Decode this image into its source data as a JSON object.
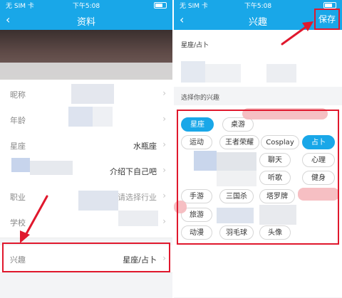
{
  "left": {
    "status": {
      "carrier": "无 SIM 卡",
      "time": "下午5:08"
    },
    "nav": {
      "back_icon": "‹",
      "title": "资料"
    },
    "rows": [
      {
        "label": "昵称",
        "value": ""
      },
      {
        "label": "年龄",
        "value": ""
      },
      {
        "label": "星座",
        "value": "水瓶座"
      },
      {
        "label": "",
        "value": "介绍下自己吧"
      },
      {
        "label": "职业",
        "value": "请选择行业"
      },
      {
        "label": "学校",
        "value": ""
      },
      {
        "label": "兴趣",
        "value": "星座/占卜"
      }
    ],
    "chevron": "›"
  },
  "right": {
    "status": {
      "carrier": "无 SIM 卡",
      "time": "下午5:08"
    },
    "nav": {
      "back_icon": "‹",
      "title": "兴趣",
      "save_label": "保存"
    },
    "current_interests": "星座/占卜",
    "choose_label": "选择你的兴趣",
    "tags": [
      {
        "label": "星座",
        "selected": true
      },
      {
        "label": "桌游",
        "selected": false
      },
      {
        "label": "运动",
        "selected": false
      },
      {
        "label": "王者荣耀",
        "selected": false
      },
      {
        "label": "Cosplay",
        "selected": false
      },
      {
        "label": "占卜",
        "selected": true
      },
      {
        "label": "聊天",
        "selected": false
      },
      {
        "label": "心理",
        "selected": false
      },
      {
        "label": "听歌",
        "selected": false
      },
      {
        "label": "健身",
        "selected": false
      },
      {
        "label": "手游",
        "selected": false
      },
      {
        "label": "三国杀",
        "selected": false
      },
      {
        "label": "塔罗牌",
        "selected": false
      },
      {
        "label": "旅游",
        "selected": false
      },
      {
        "label": "动漫",
        "selected": false
      },
      {
        "label": "羽毛球",
        "selected": false
      },
      {
        "label": "头像",
        "selected": false
      }
    ]
  },
  "colors": {
    "accent": "#19a7e8",
    "highlight": "#e0182d"
  }
}
